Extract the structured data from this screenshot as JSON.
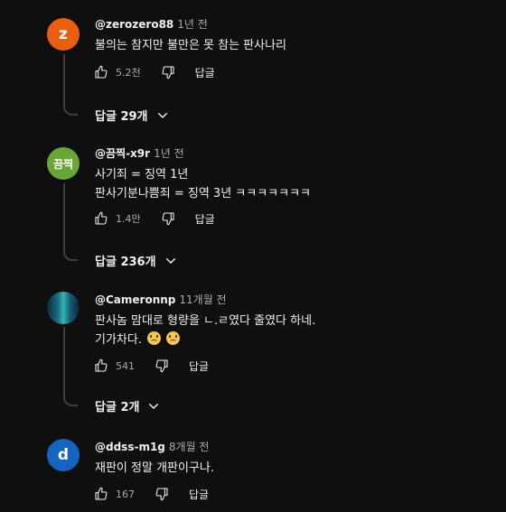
{
  "comments": [
    {
      "avatar": {
        "letter": "z",
        "color": "#e8600f"
      },
      "author": "@zerozero88",
      "time": "1년 전",
      "lines": [
        "불의는 참지만 불만은 못 참는 판사나리"
      ],
      "likes": "5.2천",
      "reply_label": "답글",
      "replies_label": "답글 29개"
    },
    {
      "avatar": {
        "letter": "끔찍",
        "color": "#6aa637"
      },
      "author": "@끔찍-x9r",
      "time": "1년 전",
      "lines": [
        "사기죄 = 징역 1년",
        "판사기분나쁨죄 = 징역 3년 ㅋㅋㅋㅋㅋㅋㅋ"
      ],
      "likes": "1.4만",
      "reply_label": "답글",
      "replies_label": "답글 236개"
    },
    {
      "avatar": {
        "letter": "",
        "color": "#1d6a7a"
      },
      "author": "@Cameronnp",
      "time": "11개월 전",
      "lines": [
        "판사놈 맘대로 형량을 ㄴ.ㄹ였다 줄였다 하네.",
        "기가차다."
      ],
      "likes": "541",
      "reply_label": "답글",
      "replies_label": "답글 2개"
    },
    {
      "avatar": {
        "letter": "d",
        "color": "#1565c0"
      },
      "author": "@ddss-m1g",
      "time": "8개월 전",
      "lines": [
        "재판이 정말 개판이구나."
      ],
      "likes": "167",
      "reply_label": "답글"
    }
  ],
  "icons": {
    "like": "thumbs-up-icon",
    "dislike": "thumbs-down-icon",
    "expand": "chevron-down-icon",
    "emoji": "sad-face-emoji"
  }
}
